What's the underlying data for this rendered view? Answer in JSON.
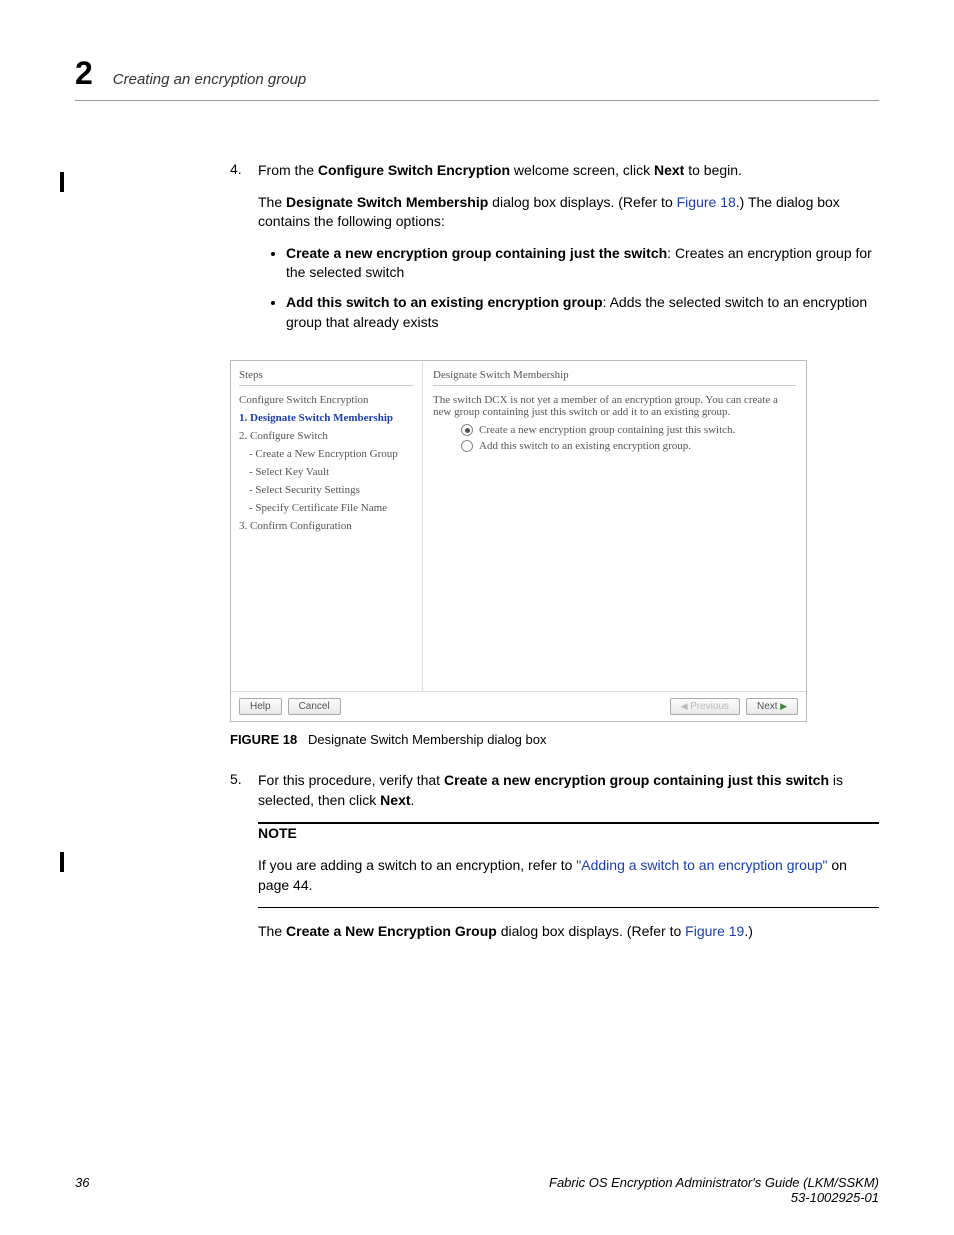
{
  "header": {
    "chapter_number": "2",
    "section_title": "Creating an encryption group"
  },
  "steps": {
    "s4": {
      "num": "4.",
      "p1_pre": "From the ",
      "p1_b1": "Configure Switch Encryption",
      "p1_mid": " welcome screen, click ",
      "p1_b2": "Next",
      "p1_post": " to begin.",
      "p2_pre": "The ",
      "p2_b1": "Designate Switch Membership",
      "p2_mid": " dialog box displays. (Refer to ",
      "p2_link": "Figure 18",
      "p2_post": ".) The dialog box contains the following options:",
      "bullet1_b": "Create a new encryption group containing just the switch",
      "bullet1_rest": ": Creates an encryption group for the selected switch",
      "bullet2_b": "Add this switch to an existing encryption group",
      "bullet2_rest": ": Adds the selected switch to an encryption group that already exists"
    },
    "s5": {
      "num": "5.",
      "p1_pre": "For this procedure, verify that ",
      "p1_b1": "Create a new encryption group containing just this switch",
      "p1_mid": " is selected, then click ",
      "p1_b2": "Next",
      "p1_post": ".",
      "note_title": "NOTE",
      "note_pre": "If you are adding a switch to an encryption, refer to ",
      "note_link": "\"Adding a switch to an encryption group\"",
      "note_post": " on page 44.",
      "p2_pre": "The ",
      "p2_b1": "Create a New Encryption Group",
      "p2_mid": " dialog box displays. (Refer to ",
      "p2_link": "Figure 19",
      "p2_post": ".)"
    }
  },
  "figure": {
    "caption_label": "FIGURE 18",
    "caption_text": "Designate Switch Membership dialog box",
    "sidebar_title": "Steps",
    "main_title": "Designate Switch Membership",
    "sidebar_items": {
      "i0": "Configure Switch Encryption",
      "i1": "1. Designate Switch Membership",
      "i2": "2. Configure Switch",
      "i3": "- Create a New Encryption Group",
      "i4": "- Select Key Vault",
      "i5": "- Select Security Settings",
      "i6": "- Specify Certificate File Name",
      "i7": "3. Confirm Configuration"
    },
    "main_intro": "The switch DCX is not yet a member of an encryption group. You can create a new group containing just this switch or add it to an existing group.",
    "radio1": "Create a new encryption group containing just this switch.",
    "radio2": "Add this switch to an existing encryption group.",
    "btn_help": "Help",
    "btn_cancel": "Cancel",
    "btn_prev": "Previous",
    "btn_next": "Next"
  },
  "footer": {
    "page_num": "36",
    "doc_title": "Fabric OS Encryption Administrator's Guide  (LKM/SSKM)",
    "doc_id": "53-1002925-01"
  }
}
